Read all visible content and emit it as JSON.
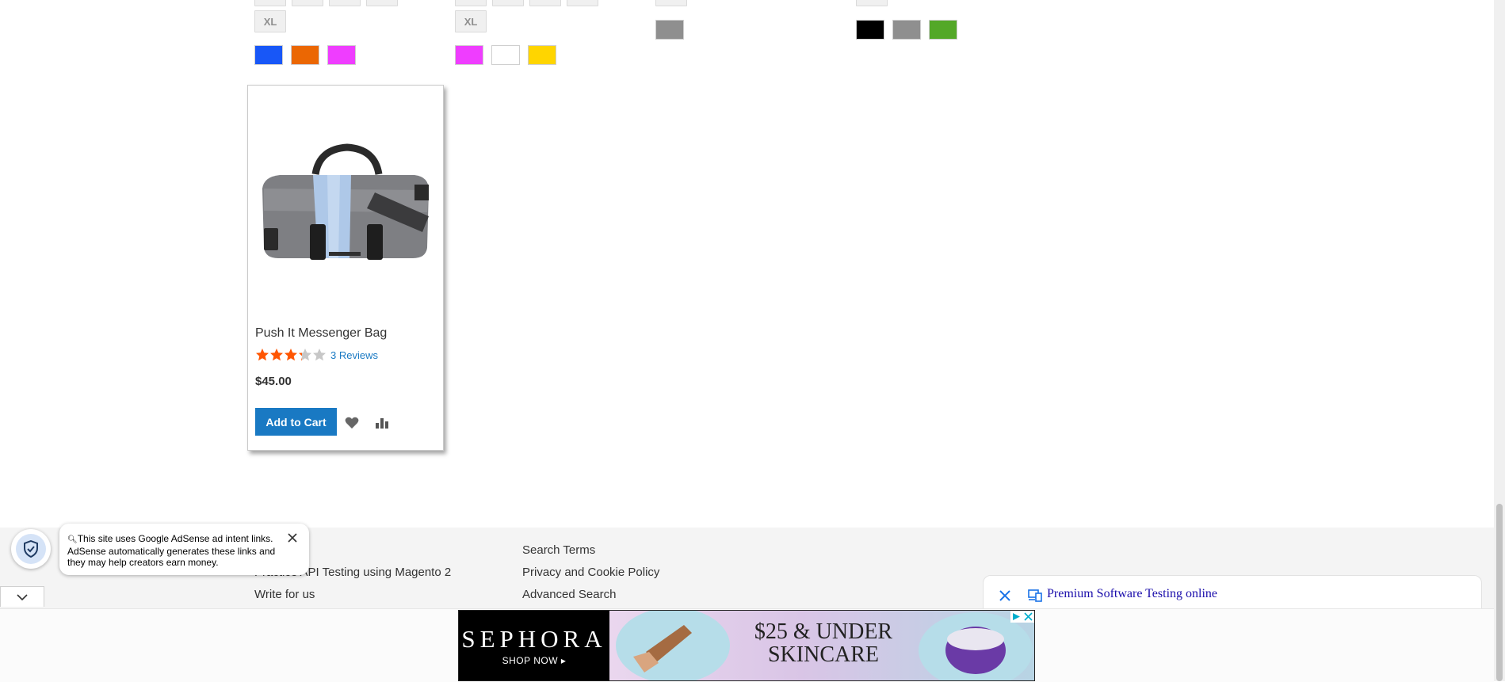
{
  "swatches": {
    "size_xl_col1": "XL",
    "size_xl_col2": "XL",
    "colors": {
      "blue": "#1857f7",
      "orange": "#eb6703",
      "purple": "#ef3dff",
      "white": "#ffffff",
      "yellow": "#ffd500",
      "gray": "#8f8f8f",
      "black": "#000000",
      "green": "#53a828"
    }
  },
  "product": {
    "name": "Push It Messenger Bag",
    "rating_percent": 65,
    "reviews_label": "3 Reviews",
    "price": "$45.00",
    "add_to_cart_label": "Add to Cart"
  },
  "footer": {
    "links_col1": [
      "Practice API Testing using Magento 2",
      "Write for us"
    ],
    "links_col2": [
      "Search Terms",
      "Privacy and Cookie Policy",
      "Advanced Search"
    ]
  },
  "adsense_notice": {
    "text": "This site uses Google AdSense ad intent links. AdSense automatically generates these links and they may help creators earn money."
  },
  "ad_strip": {
    "text": "Premium Software Testing online"
  },
  "banner_ad": {
    "brand": "SEPHORA",
    "cta": "SHOP NOW ▸",
    "headline_line1": "$25 & UNDER",
    "headline_line2": "SKINCARE"
  }
}
